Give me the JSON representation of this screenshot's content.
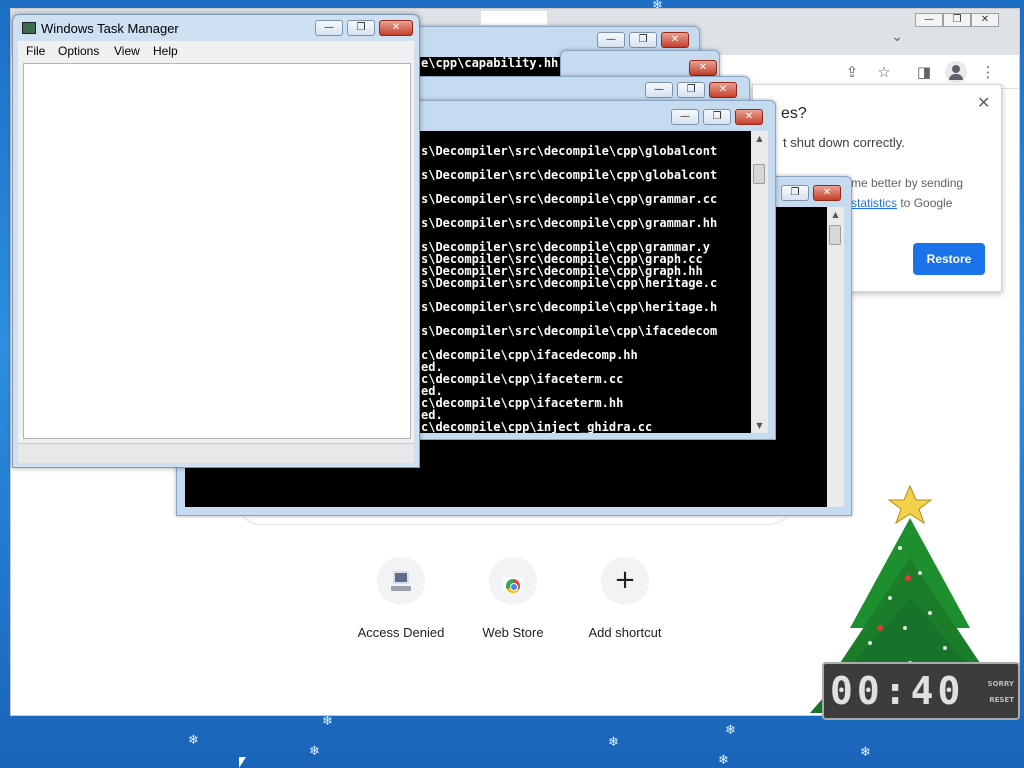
{
  "browser": {
    "titlebar_controls": [
      "—",
      "❐",
      "✕"
    ],
    "tab_search_icon": "chevron-down-icon",
    "toolbar_icons": [
      "share-icon",
      "star-icon",
      "side-panel-icon",
      "profile-icon",
      "kebab-menu-icon"
    ],
    "shortcuts": [
      {
        "label": "Access Denied",
        "icon": "computer-icon"
      },
      {
        "label": "Web Store",
        "icon": "web-store-icon"
      },
      {
        "label": "Add shortcut",
        "icon": "plus-icon"
      }
    ]
  },
  "restore_popup": {
    "title_fragment": "es?",
    "text": "t shut down correctly.",
    "consent_line1": "me better by sending",
    "consent_link": "statistics",
    "consent_after_link": " to Google",
    "button_label": "Restore",
    "close_glyph": "✕"
  },
  "console_back": {
    "title_fragment": "",
    "line": "e\\cpp\\capability.hh"
  },
  "console_front": {
    "lines": [
      "s\\Decompiler\\src\\decompile\\cpp\\globalcont",
      "",
      "s\\Decompiler\\src\\decompile\\cpp\\globalcont",
      "",
      "s\\Decompiler\\src\\decompile\\cpp\\grammar.cc",
      "",
      "s\\Decompiler\\src\\decompile\\cpp\\grammar.hh",
      "",
      "s\\Decompiler\\src\\decompile\\cpp\\grammar.y",
      "s\\Decompiler\\src\\decompile\\cpp\\graph.cc",
      "s\\Decompiler\\src\\decompile\\cpp\\graph.hh",
      "s\\Decompiler\\src\\decompile\\cpp\\heritage.c",
      "",
      "s\\Decompiler\\src\\decompile\\cpp\\heritage.h",
      "",
      "s\\Decompiler\\src\\decompile\\cpp\\ifacedecom",
      "",
      "c\\decompile\\cpp\\ifacedecomp.hh",
      "ed.",
      "c\\decompile\\cpp\\ifaceterm.cc",
      "ed.",
      "c\\decompile\\cpp\\ifaceterm.hh",
      "ed.",
      "c\\decompile\\cpp\\inject_ghidra.cc"
    ]
  },
  "task_manager": {
    "title": "Windows Task Manager",
    "menu": [
      "File",
      "Options",
      "View",
      "Help"
    ],
    "controls": [
      "—",
      "❐",
      "✕"
    ]
  },
  "clock": {
    "digits": "00:40",
    "side_top": "SORRY",
    "side_bottom": "RESET"
  },
  "colors": {
    "desktop": "#2c8fe0",
    "chrome_blue": "#1a73e8",
    "console_bg": "#000000",
    "console_fg": "#ffffff"
  }
}
